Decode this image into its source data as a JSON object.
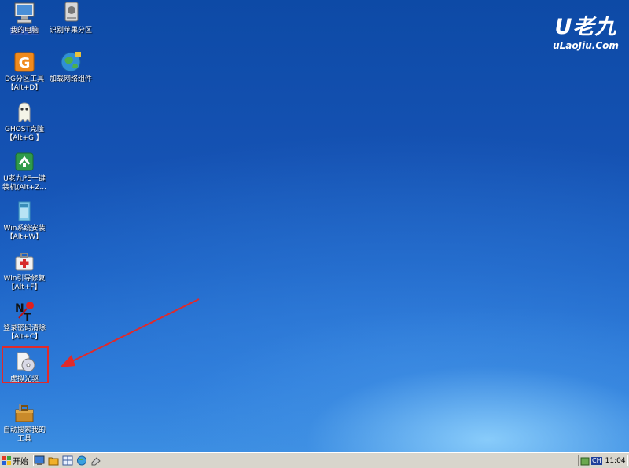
{
  "brand": {
    "logo": "U老九",
    "url": "uLaoJiu.Com"
  },
  "icons": [
    {
      "label": "我的电脑",
      "sub": ""
    },
    {
      "label": "识别苹果分区",
      "sub": ""
    },
    {
      "label": "DG分区工具",
      "sub": "【Alt+D】"
    },
    {
      "label": "加载网络组件",
      "sub": ""
    },
    {
      "label": "GHOST克隆",
      "sub": "【Alt+G 】"
    },
    {
      "label": "U老九PE一键",
      "sub": "装机(Alt+Z..."
    },
    {
      "label": "Win系统安装",
      "sub": "【Alt+W】"
    },
    {
      "label": "Win引导修复",
      "sub": "【Alt+F】"
    },
    {
      "label": "登录密码清除",
      "sub": "【Alt+C】"
    },
    {
      "label": "虚拟光驱",
      "sub": ""
    },
    {
      "label": "自动搜索我的",
      "sub": "工具"
    }
  ],
  "taskbar": {
    "start_label": "开始",
    "lang": "CH",
    "clock": "11:04"
  },
  "colors": {
    "highlight": "#e12a2a",
    "desktop": "#1552b3",
    "taskbar": "#d8d5cc"
  }
}
